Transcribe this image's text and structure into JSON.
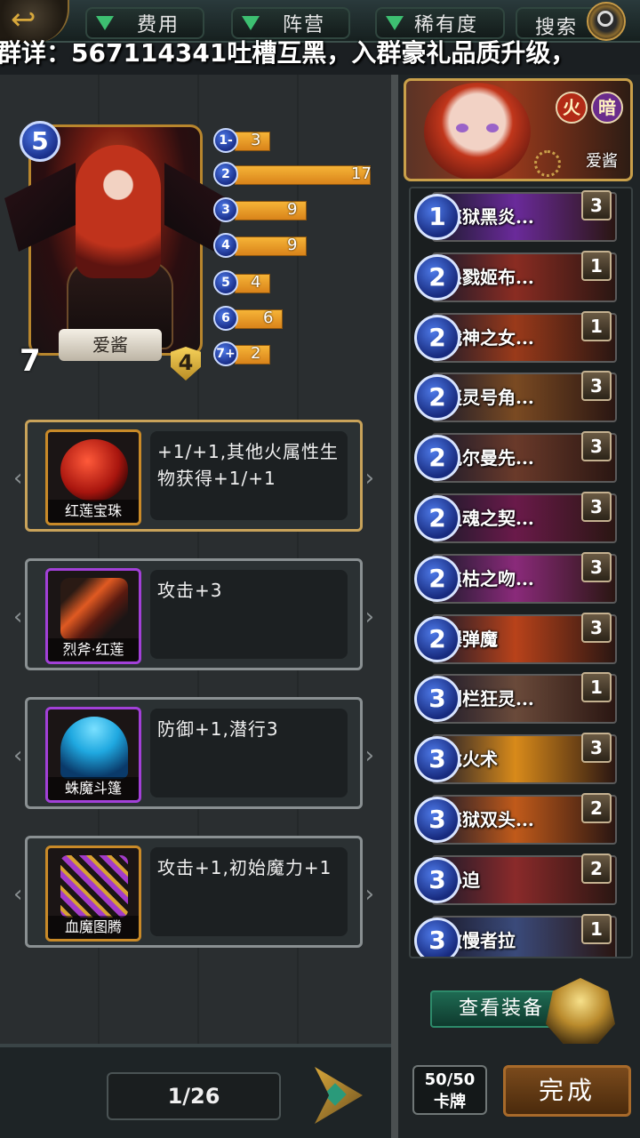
{
  "topbar": {
    "tabs": [
      {
        "label": "费用"
      },
      {
        "label": "阵营"
      },
      {
        "label": "稀有度"
      }
    ],
    "search_label": "搜索"
  },
  "marquee": "群详：567114341吐槽互黑，入群豪礼品质升级，",
  "hero": {
    "cost": "5",
    "name": "爱酱",
    "attack": "7",
    "defense": "4"
  },
  "mana_curve": [
    {
      "label": "1-",
      "count": 3
    },
    {
      "label": "2",
      "count": 17
    },
    {
      "label": "3",
      "count": 9
    },
    {
      "label": "4",
      "count": 9
    },
    {
      "label": "5",
      "count": 4
    },
    {
      "label": "6",
      "count": 6
    },
    {
      "label": "7+",
      "count": 2
    }
  ],
  "equipment": [
    {
      "name": "红莲宝珠",
      "desc": "+1/+1,其他火属性生物获得+1/+1",
      "rarity": "legendary",
      "color": "#c4221a"
    },
    {
      "name": "烈斧·红莲",
      "desc": "攻击+3",
      "rarity": "epic",
      "color": "#e05a22"
    },
    {
      "name": "蛛魔斗篷",
      "desc": "防御+1,潜行3",
      "rarity": "epic",
      "color": "#1fa8e0"
    },
    {
      "name": "血魔图腾",
      "desc": "攻击+1,初始魔力+1",
      "rarity": "legendary",
      "color": "#a33cc8"
    }
  ],
  "pager": {
    "text": "1/26"
  },
  "deck": {
    "hero_name": "爱酱",
    "elements": [
      "火",
      "暗"
    ],
    "cards": [
      {
        "cost": "1",
        "name": "炼狱黑炎...",
        "count": "3",
        "color": "#6a2a9a"
      },
      {
        "cost": "2",
        "name": "杀戮姬布...",
        "count": "1",
        "color": "#8a2c22"
      },
      {
        "cost": "2",
        "name": "战神之女...",
        "count": "1",
        "color": "#9a3a1a"
      },
      {
        "cost": "2",
        "name": "英灵号角...",
        "count": "3",
        "color": "#7a4a22"
      },
      {
        "cost": "2",
        "name": "凯尔曼先...",
        "count": "3",
        "color": "#6a3a2a"
      },
      {
        "cost": "2",
        "name": "灵魂之契...",
        "count": "3",
        "color": "#6a1a4a"
      },
      {
        "cost": "2",
        "name": "焦枯之吻...",
        "count": "3",
        "color": "#8a2a7a"
      },
      {
        "cost": "2",
        "name": "爆弹魔",
        "count": "3",
        "color": "#b8421a"
      },
      {
        "cost": "3",
        "name": "剑栏狂灵...",
        "count": "1",
        "color": "#6a4a3a"
      },
      {
        "cost": "3",
        "name": "龙火术",
        "count": "3",
        "color": "#d88a1a"
      },
      {
        "cost": "3",
        "name": "炼狱双头...",
        "count": "2",
        "color": "#c05a1a"
      },
      {
        "cost": "3",
        "name": "胁迫",
        "count": "2",
        "color": "#8a2a2a"
      },
      {
        "cost": "3",
        "name": "傲慢者拉",
        "count": "1",
        "color": "#3a4a7a"
      }
    ],
    "view_equipment_label": "查看装备",
    "card_count": "50/50",
    "card_count_unit": "卡牌",
    "done_label": "完成"
  }
}
